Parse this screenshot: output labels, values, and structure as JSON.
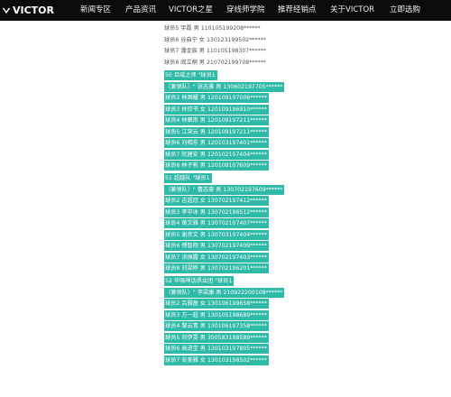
{
  "nav": {
    "logo_text": "VICTOR",
    "items": [
      "新闻专区",
      "产品资讯",
      "VICTOR之星",
      "穿线师学院",
      "推荐经销点",
      "关于VICTOR",
      "立即选购"
    ]
  },
  "colors": {
    "nav_bg": "#0b0b0b",
    "highlight": "#2fb9a7",
    "text": "#555555"
  },
  "rows": [
    "球员5 宇磊 男 110105199208******",
    "球员6 谷启宁 女 130123199502******",
    "球员7 潘金宸 男 110105198307******",
    "球员8 阎立桐 男 210702199708******",
    "50 巨威之师 \"球员1",
    "（兼领队）\" 张志雅 男 130602197705******",
    "球员2 林国耀 男 120109197006******",
    "球员3 林佼书 女 120109196910******",
    "球员4 林雁南 男 120109197211******",
    "球员5 江突云 男 120109197211******",
    "球员6 刘相东 男 120103197401******",
    "球员7 阮建安 男 120102197404******",
    "球员8 林子帆 男 120109197609******",
    "51 超越队 \"球员1",
    "（兼领队）\" 曹志豪 男 130702197609******",
    "球员2 吉超冠 女 130702197412******",
    "球员3 李中冰 男 130702196512******",
    "球员4 黄文雅 男 130702197407******",
    "球员5 谢彦文 男 130703197404******",
    "球员6 傅智翔 男 130702197409******",
    "球员7 洪振露 女 130702197403******",
    "球员8 刘梁桦 男 130702196201******",
    "52 华强神话俱业团 \"球员1",
    "（兼领队）\" 李梁康 男 210922200108******",
    "球员2 吕雅盈 女 130106199658******",
    "球员3 方一超 男 130105198689******",
    "球员4 黎云青 男 130106197358******",
    "球员5 邓伊雯 男 350583198589******",
    "球员6 高进宝 男 130103197805******",
    "球员7 安美雅 女 130103198502******"
  ]
}
